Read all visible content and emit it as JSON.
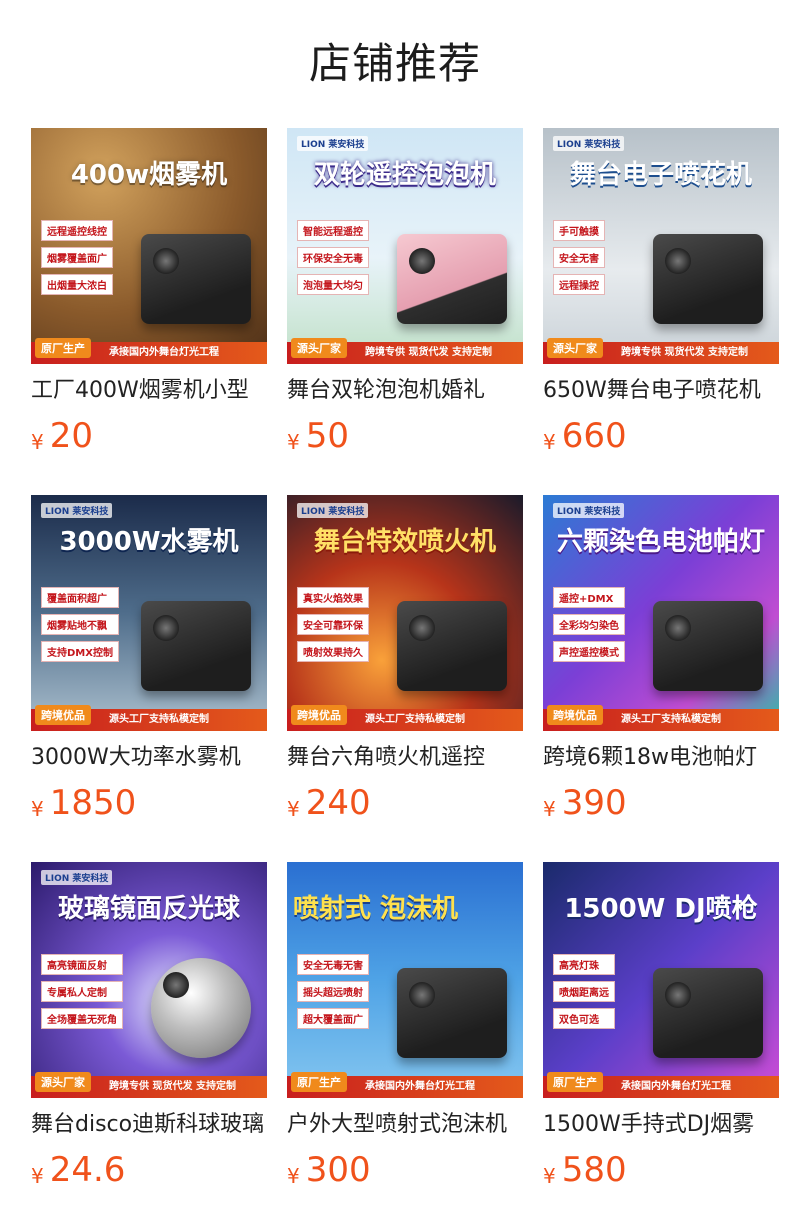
{
  "page": {
    "title": "店铺推荐"
  },
  "products": [
    {
      "name": "工厂400W烟雾机小型",
      "currency": "¥",
      "price": "20",
      "image": {
        "brand": "",
        "headline": "400w烟雾机",
        "tags": [
          "远程遥控线控",
          "烟雾覆盖面广",
          "出烟量大浓白"
        ],
        "badge": "原厂生产",
        "footer": "承接国内外舞台灯光工程"
      }
    },
    {
      "name": "舞台双轮泡泡机婚礼",
      "currency": "¥",
      "price": "50",
      "image": {
        "brand": "LION 莱安科技",
        "headline": "双轮遥控泡泡机",
        "tags": [
          "智能远程遥控",
          "环保安全无毒",
          "泡泡量大均匀"
        ],
        "badge": "源头厂家",
        "footer": "跨境专供  现货代发  支持定制"
      }
    },
    {
      "name": "650W舞台电子喷花机",
      "currency": "¥",
      "price": "660",
      "image": {
        "brand": "LION 莱安科技",
        "headline": "舞台电子喷花机",
        "tags": [
          "手可触摸",
          "安全无害",
          "远程操控"
        ],
        "badge": "源头厂家",
        "footer": "跨境专供  现货代发  支持定制"
      }
    },
    {
      "name": "3000W大功率水雾机",
      "currency": "¥",
      "price": "1850",
      "image": {
        "brand": "LION 莱安科技",
        "headline": "3000W水雾机",
        "tags": [
          "覆盖面积超广",
          "烟雾贴地不飘",
          "支持DMX控制"
        ],
        "badge": "跨境优品",
        "footer": "源头工厂支持私模定制"
      }
    },
    {
      "name": "舞台六角喷火机遥控",
      "currency": "¥",
      "price": "240",
      "image": {
        "brand": "LION 莱安科技",
        "headline": "舞台特效喷火机",
        "tags": [
          "真实火焰效果",
          "安全可靠环保",
          "喷射效果持久"
        ],
        "badge": "跨境优品",
        "footer": "源头工厂支持私模定制"
      }
    },
    {
      "name": "跨境6颗18w电池帕灯",
      "currency": "¥",
      "price": "390",
      "image": {
        "brand": "LION 莱安科技",
        "headline": "六颗染色电池帕灯",
        "tags": [
          "遥控+DMX",
          "全彩均匀染色",
          "声控遥控模式"
        ],
        "badge": "跨境优品",
        "footer": "源头工厂支持私模定制"
      }
    },
    {
      "name": "舞台disco迪斯科球玻璃",
      "currency": "¥",
      "price": "24.6",
      "image": {
        "brand": "LION 莱安科技",
        "headline": "玻璃镜面反光球",
        "tags": [
          "高亮镜面反射",
          "专属私人定制",
          "全场覆盖无死角"
        ],
        "badge": "源头厂家",
        "footer": "跨境专供  现货代发  支持定制"
      }
    },
    {
      "name": "户外大型喷射式泡沫机",
      "currency": "¥",
      "price": "300",
      "image": {
        "brand": "",
        "headline": "喷射式 泡沫机",
        "tags": [
          "安全无毒无害",
          "摇头超远喷射",
          "超大覆盖面广"
        ],
        "badge": "原厂生产",
        "footer": "承接国内外舞台灯光工程"
      }
    },
    {
      "name": "1500W手持式DJ烟雾",
      "currency": "¥",
      "price": "580",
      "image": {
        "brand": "",
        "headline": "1500W DJ喷枪",
        "tags": [
          "高亮灯珠",
          "喷烟距离远",
          "双色可选"
        ],
        "badge": "原厂生产",
        "footer": "承接国内外舞台灯光工程"
      }
    }
  ]
}
